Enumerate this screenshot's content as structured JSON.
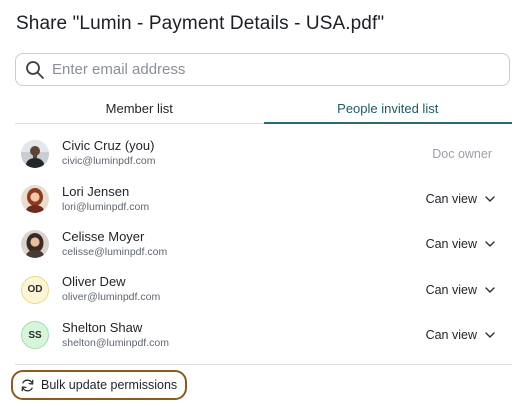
{
  "dialog": {
    "title": "Share \"Lumin - Payment Details - USA.pdf\""
  },
  "search": {
    "placeholder": "Enter email address",
    "value": ""
  },
  "tabs": [
    {
      "label": "Member list",
      "active": false
    },
    {
      "label": "People invited list",
      "active": true
    }
  ],
  "members": [
    {
      "name": "Civic Cruz (you)",
      "email": "civic@luminpdf.com",
      "role": "Doc owner",
      "avatar": {
        "type": "photo",
        "icon": "person-photo-male"
      }
    },
    {
      "name": "Lori Jensen",
      "email": "lori@luminpdf.com",
      "role": "Can view",
      "avatar": {
        "type": "photo",
        "icon": "person-photo-female-red-hair"
      }
    },
    {
      "name": "Celisse Moyer",
      "email": "celisse@luminpdf.com",
      "role": "Can view",
      "avatar": {
        "type": "photo",
        "icon": "person-photo-female-dark-hair"
      }
    },
    {
      "name": "Oliver Dew",
      "email": "oliver@luminpdf.com",
      "role": "Can view",
      "avatar": {
        "type": "initials",
        "initials": "OD",
        "bg": "#fdf6d6",
        "border": "#e9d98c"
      }
    },
    {
      "name": "Shelton Shaw",
      "email": "shelton@luminpdf.com",
      "role": "Can view",
      "avatar": {
        "type": "initials",
        "initials": "SS",
        "bg": "#d6f5d9",
        "border": "#a8dcae"
      }
    }
  ],
  "bulk_action": {
    "label": "Bulk update permissions",
    "icon": "refresh-icon"
  },
  "colors": {
    "accent": "#2a6b73",
    "highlight_border": "#8a5a1e",
    "muted_text": "#9aa0a8"
  }
}
